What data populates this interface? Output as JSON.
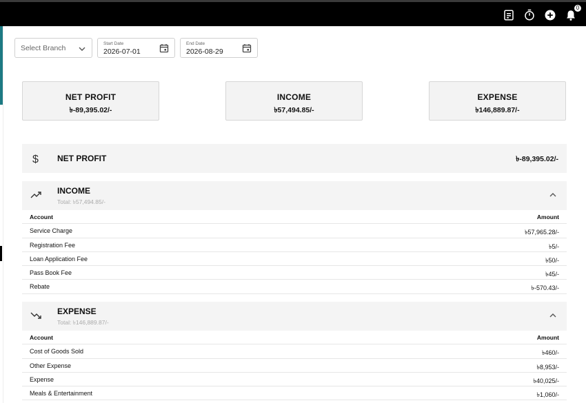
{
  "topbar": {
    "icons": [
      "notes-icon",
      "timer-icon",
      "add-circle-icon",
      "bell-icon"
    ],
    "notification_count": "0"
  },
  "filters": {
    "branch_placeholder": "Select Branch",
    "start_label": "Start Date",
    "start_value": "2026-07-01",
    "end_label": "End Date",
    "end_value": "2026-08-29"
  },
  "summary": {
    "net_profit": {
      "title": "NET PROFIT",
      "value": "৳-89,395.02/-"
    },
    "income": {
      "title": "INCOME",
      "value": "৳57,494.85/-"
    },
    "expense": {
      "title": "EXPENSE",
      "value": "৳146,889.87/-"
    }
  },
  "net_profit_row": {
    "title": "NET PROFIT",
    "value": "৳-89,395.02/-"
  },
  "income": {
    "title": "INCOME",
    "total": "Total: ৳57,494.85/-",
    "col_account": "Account",
    "col_amount": "Amount",
    "rows": [
      {
        "account": "Service Charge",
        "amount": "৳57,965.28/-"
      },
      {
        "account": "Registration Fee",
        "amount": "৳5/-"
      },
      {
        "account": "Loan Application Fee",
        "amount": "৳50/-"
      },
      {
        "account": "Pass Book Fee",
        "amount": "৳45/-"
      },
      {
        "account": "Rebate",
        "amount": "৳-570.43/-"
      }
    ]
  },
  "expense": {
    "title": "EXPENSE",
    "total": "Total: ৳146,889.87/-",
    "col_account": "Account",
    "col_amount": "Amount",
    "rows": [
      {
        "account": "Cost of Goods Sold",
        "amount": "৳460/-"
      },
      {
        "account": "Other Expense",
        "amount": "৳8,953/-"
      },
      {
        "account": "Expense",
        "amount": "৳40,025/-"
      },
      {
        "account": "Meals & Entertainment",
        "amount": "৳1,060/-"
      }
    ]
  },
  "colors": {
    "topbar": "#000000",
    "accent": "#1d7a83",
    "panel": "#f4f4f4"
  }
}
